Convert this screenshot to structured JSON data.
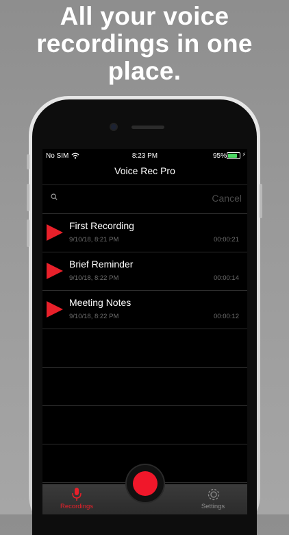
{
  "promo": {
    "headline_line1": "All your voice",
    "headline_line2": "recordings in one",
    "headline_line3": "place."
  },
  "status_bar": {
    "carrier": "No SIM",
    "time": "8:23 PM",
    "battery": "95%"
  },
  "nav": {
    "title": "Voice Rec Pro"
  },
  "search": {
    "cancel_label": "Cancel"
  },
  "recordings": [
    {
      "title": "First Recording",
      "date": "9/10/18, 8:21 PM",
      "duration": "00:00:21"
    },
    {
      "title": "Brief Reminder",
      "date": "9/10/18, 8:22 PM",
      "duration": "00:00:14"
    },
    {
      "title": "Meeting Notes",
      "date": "9/10/18, 8:22 PM",
      "duration": "00:00:12"
    }
  ],
  "tabbar": {
    "recordings_label": "Recordings",
    "settings_label": "Settings"
  },
  "colors": {
    "accent": "#e8202a",
    "battery": "#4cd964"
  },
  "icons": [
    "search-icon",
    "play-icon",
    "mic-icon",
    "gear-icon",
    "wifi-icon",
    "battery-icon",
    "record-icon"
  ]
}
